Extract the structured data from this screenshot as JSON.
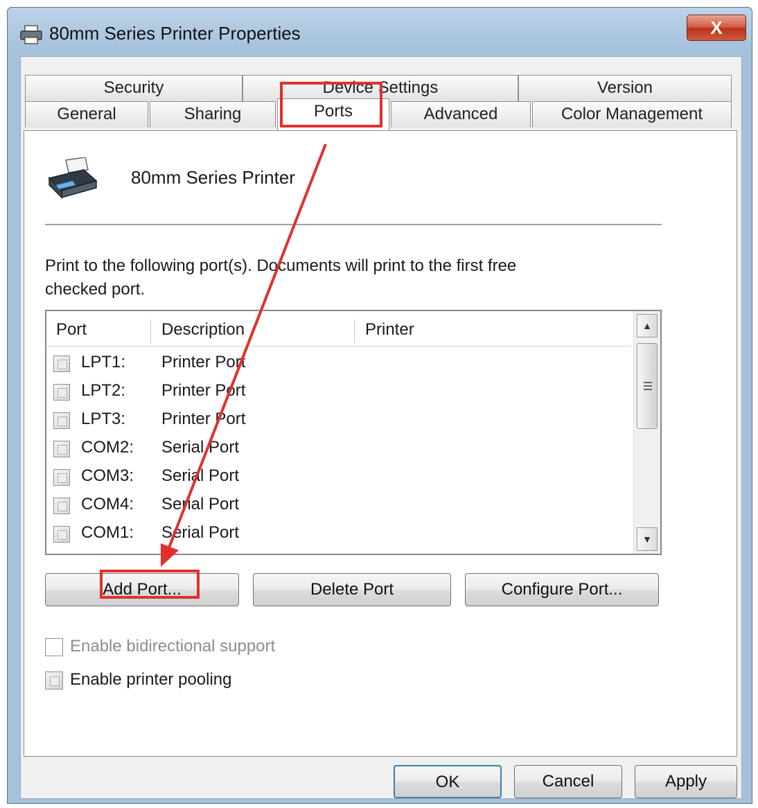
{
  "window": {
    "title": "80mm Series Printer Properties",
    "close_glyph": "X"
  },
  "tabs": {
    "row1": [
      {
        "label": "Security"
      },
      {
        "label": "Device Settings"
      },
      {
        "label": "Version"
      }
    ],
    "row2": [
      {
        "label": "General"
      },
      {
        "label": "Sharing"
      },
      {
        "label": "Ports",
        "active": true
      },
      {
        "label": "Advanced"
      },
      {
        "label": "Color Management"
      }
    ]
  },
  "ports_page": {
    "printer_name": "80mm Series Printer",
    "description_line1": "Print to the following port(s). Documents will print to the first free",
    "description_line2": "checked port.",
    "columns": [
      "Port",
      "Description",
      "Printer"
    ],
    "rows": [
      {
        "port": "LPT1:",
        "description": "Printer Port",
        "printer": ""
      },
      {
        "port": "LPT2:",
        "description": "Printer Port",
        "printer": ""
      },
      {
        "port": "LPT3:",
        "description": "Printer Port",
        "printer": ""
      },
      {
        "port": "COM2:",
        "description": "Serial Port",
        "printer": ""
      },
      {
        "port": "COM3:",
        "description": "Serial Port",
        "printer": ""
      },
      {
        "port": "COM4:",
        "description": "Serial Port",
        "printer": ""
      },
      {
        "port": "COM1:",
        "description": "Serial Port",
        "printer": ""
      }
    ],
    "add_port_label": "Add Port...",
    "delete_port_label": "Delete Port",
    "configure_port_label": "Configure Port...",
    "bidirectional_label": "Enable bidirectional support",
    "pooling_label": "Enable printer pooling"
  },
  "footer": {
    "ok_label": "OK",
    "cancel_label": "Cancel",
    "apply_label": "Apply"
  },
  "colors": {
    "annotation": "#e0312d",
    "title_bar": "#a6c1dc",
    "close_button": "#c9452b"
  }
}
